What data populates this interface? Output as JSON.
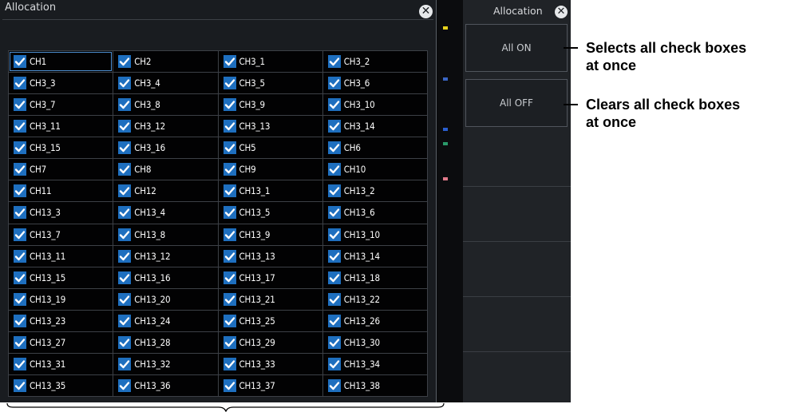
{
  "dialog": {
    "title": "Allocation"
  },
  "channels": [
    "CH1",
    "CH2",
    "CH3_1",
    "CH3_2",
    "CH3_3",
    "CH3_4",
    "CH3_5",
    "CH3_6",
    "CH3_7",
    "CH3_8",
    "CH3_9",
    "CH3_10",
    "CH3_11",
    "CH3_12",
    "CH3_13",
    "CH3_14",
    "CH3_15",
    "CH3_16",
    "CH5",
    "CH6",
    "CH7",
    "CH8",
    "CH9",
    "CH10",
    "CH11",
    "CH12",
    "CH13_1",
    "CH13_2",
    "CH13_3",
    "CH13_4",
    "CH13_5",
    "CH13_6",
    "CH13_7",
    "CH13_8",
    "CH13_9",
    "CH13_10",
    "CH13_11",
    "CH13_12",
    "CH13_13",
    "CH13_14",
    "CH13_15",
    "CH13_16",
    "CH13_17",
    "CH13_18",
    "CH13_19",
    "CH13_20",
    "CH13_21",
    "CH13_22",
    "CH13_23",
    "CH13_24",
    "CH13_25",
    "CH13_26",
    "CH13_27",
    "CH13_28",
    "CH13_29",
    "CH13_30",
    "CH13_31",
    "CH13_32",
    "CH13_33",
    "CH13_34",
    "CH13_35",
    "CH13_36",
    "CH13_37",
    "CH13_38"
  ],
  "all_checked": true,
  "side_menu": {
    "title": "Allocation",
    "all_on_label": "All ON",
    "all_off_label": "All OFF"
  },
  "annotations": {
    "all_on_line1": "Selects all check boxes",
    "all_on_line2": "at once",
    "all_off_line1": "Clears all check boxes",
    "all_off_line2": "at once"
  },
  "colors": {
    "checkbox": "#1e6fbf",
    "focus": "#4d8ed0",
    "panel": "#191c20"
  },
  "icons": [
    "close-icon",
    "check-icon"
  ]
}
